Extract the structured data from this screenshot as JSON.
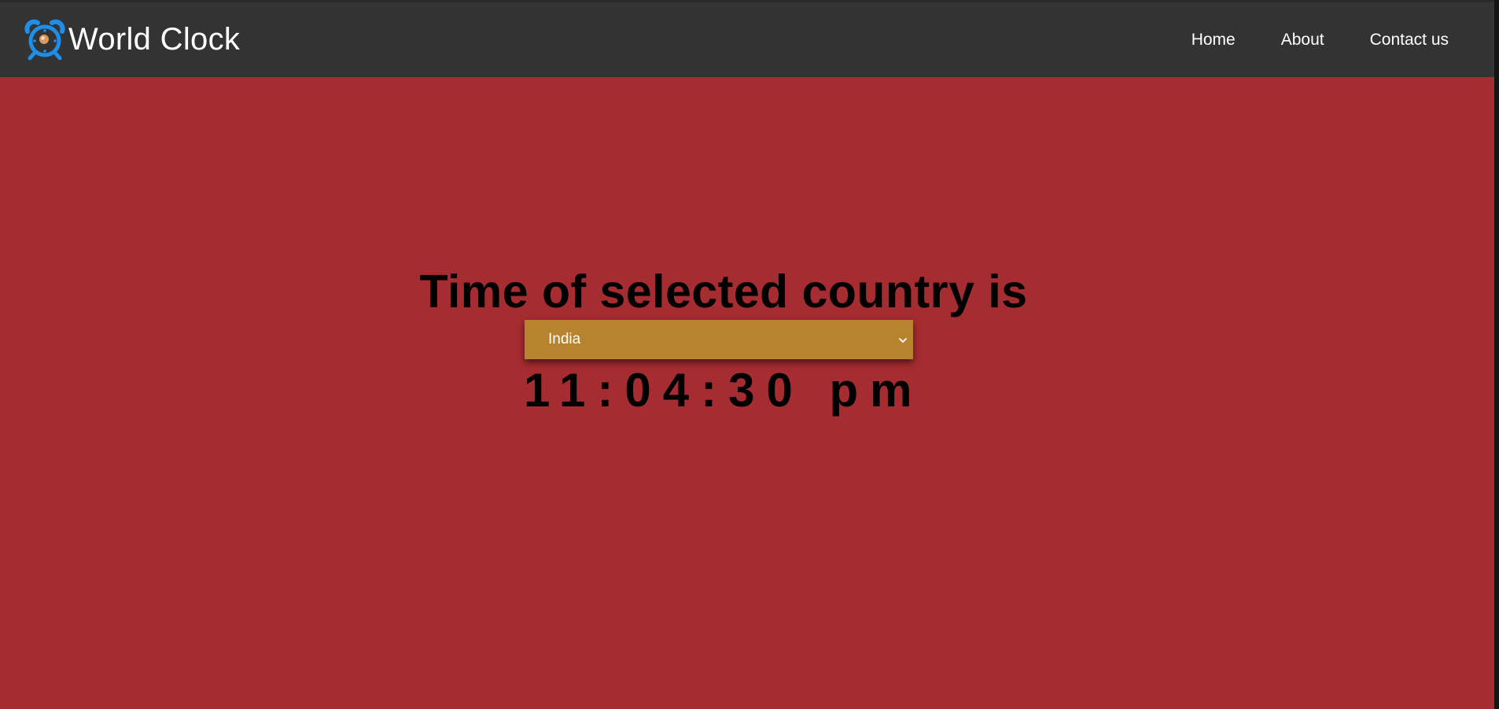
{
  "app": {
    "title": "World Clock",
    "brand_icon": "alarm-clock-icon",
    "colors": {
      "navbar": "#333333",
      "background": "#a52c30",
      "select_bg": "#b8832e",
      "icon_blue": "#1f8ee6"
    }
  },
  "nav": {
    "items": [
      {
        "label": "Home"
      },
      {
        "label": "About"
      },
      {
        "label": "Contact us"
      }
    ]
  },
  "main": {
    "heading": "Time of selected country is",
    "country_select": {
      "selected": "India",
      "icon": "chevron-down-icon"
    },
    "time": "11:04:30 pm"
  }
}
